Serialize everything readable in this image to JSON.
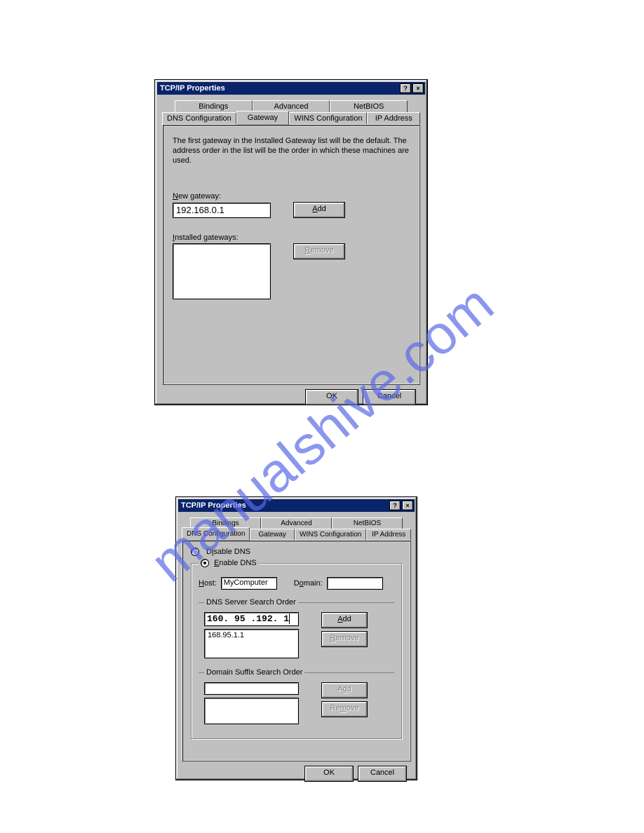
{
  "watermark": "manualshive.com",
  "dialog1": {
    "title": "TCP/IP Properties",
    "tabs_row1": [
      "Bindings",
      "Advanced",
      "NetBIOS"
    ],
    "tabs_row2": [
      "DNS Configuration",
      "Gateway",
      "WINS Configuration",
      "IP Address"
    ],
    "active_tab": "Gateway",
    "description": "The first gateway in the Installed Gateway list will be the default. The address order in the list will be the order in which these machines are used.",
    "new_gateway_label": "New gateway:",
    "new_gateway_value": "192.168.0.1",
    "add_button": "Add",
    "installed_gateways_label": "Installed gateways:",
    "remove_button": "Remove",
    "ok_button": "OK",
    "cancel_button": "Cancel"
  },
  "dialog2": {
    "title": "TCP/IP Properties",
    "tabs_row1": [
      "Bindings",
      "Advanced",
      "NetBIOS"
    ],
    "tabs_row2": [
      "DNS Configuration",
      "Gateway",
      "WINS Configuration",
      "IP Address"
    ],
    "active_tab": "DNS Configuration",
    "disable_dns_label": "Disable DNS",
    "enable_dns_label": "Enable DNS",
    "dns_enabled": true,
    "host_label": "Host:",
    "host_value": "MyComputer",
    "domain_label": "Domain:",
    "domain_value": "",
    "dns_order_label": "DNS Server Search Order",
    "dns_input_value": "160.95.192.1",
    "dns_list": [
      "168.95.1.1"
    ],
    "add_button": "Add",
    "remove_button": "Remove",
    "suffix_order_label": "Domain Suffix Search Order",
    "suffix_input_value": "",
    "suffix_list": [],
    "ok_button": "OK",
    "cancel_button": "Cancel"
  }
}
